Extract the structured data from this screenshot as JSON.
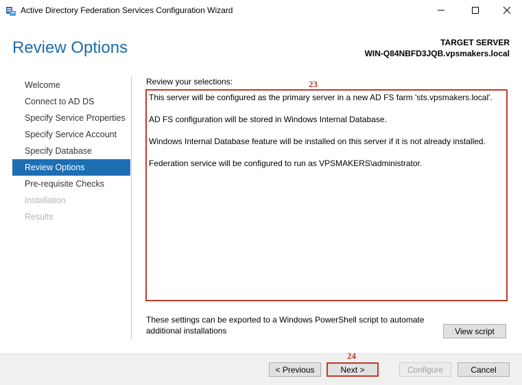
{
  "window": {
    "title": "Active Directory Federation Services Configuration Wizard",
    "icon": "adfs-wizard-icon",
    "controls": {
      "minimize_icon": "minimize-icon",
      "maximize_icon": "maximize-icon",
      "close_icon": "close-icon"
    }
  },
  "header": {
    "page_title": "Review Options",
    "target_label": "TARGET SERVER",
    "target_server": "WIN-Q84NBFD3JQB.vpsmakers.local"
  },
  "nav": {
    "items": [
      {
        "label": "Welcome",
        "state": "normal"
      },
      {
        "label": "Connect to AD DS",
        "state": "normal"
      },
      {
        "label": "Specify Service Properties",
        "state": "normal"
      },
      {
        "label": "Specify Service Account",
        "state": "normal"
      },
      {
        "label": "Specify Database",
        "state": "normal"
      },
      {
        "label": "Review Options",
        "state": "active"
      },
      {
        "label": "Pre-requisite Checks",
        "state": "normal"
      },
      {
        "label": "Installation",
        "state": "disabled"
      },
      {
        "label": "Results",
        "state": "disabled"
      }
    ]
  },
  "main": {
    "review_label": "Review your selections:",
    "review_lines": [
      "This server will be configured as the primary server in a new AD FS farm 'sts.vpsmakers.local'.",
      "AD FS configuration will be stored in Windows Internal Database.",
      "Windows Internal Database feature will be installed on this server if it is not already installed.",
      "Federation service will be configured to run as VPSMAKERS\\administrator."
    ],
    "export_note": "These settings can be exported to a Windows PowerShell script to automate additional installations",
    "view_script_label": "View script"
  },
  "annotations": {
    "marker_review": "23",
    "marker_next": "24",
    "color": "#c0392b"
  },
  "footer": {
    "previous_label": "< Previous",
    "next_label": "Next >",
    "configure_label": "Configure",
    "cancel_label": "Cancel"
  },
  "colors": {
    "accent": "#1e6eb4",
    "title": "#1e6aa8"
  }
}
